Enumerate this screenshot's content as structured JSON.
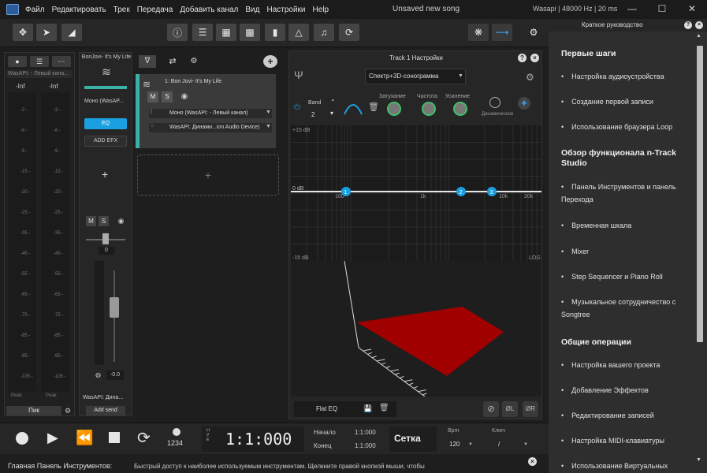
{
  "menu": [
    "Файл",
    "Редактировать",
    "Трек",
    "Передача",
    "Добавить канал",
    "Вид",
    "Настройки",
    "Help"
  ],
  "window_title": "Unsaved new song",
  "audio_info": "Wasapi | 48000 Hz | 20 ms",
  "guide": {
    "title": "Краткое руководство",
    "sections": [
      {
        "heading": "Первые шаги",
        "items": [
          "Настройка аудиоустройства",
          "Создание первой записи",
          "Использование браузера Loop"
        ]
      },
      {
        "heading": "Обзор функционала n-Track Studio",
        "items": [
          "Панель Инструментов и панель Перехода",
          "Временная шкала",
          "Mixer",
          "Step Sequencer и Piano Roll",
          "Музыкальное сотрудничество с Songtree"
        ]
      },
      {
        "heading": "Общие операции",
        "items": [
          "Настройка вашего проекта",
          "Добавление Эффектов",
          "Редактирование записей",
          "Настройка MIDI-клавиатуры",
          "Использование Виртуальных"
        ]
      }
    ]
  },
  "master": {
    "device": "WasAPI: - Левый кана...",
    "left_peak": "-Inf",
    "right_peak": "-Inf",
    "scale": [
      "-3 -",
      "-6 -",
      "-9 -",
      "-15 -",
      "-20 -",
      "-25 -",
      "-35 -",
      "-45 -",
      "-55 -",
      "-65 -",
      "-75 -",
      "-85 -",
      "-95 -",
      "-105 -"
    ],
    "peak_left": "Peak",
    "peak_right": "Peak",
    "peak_button": "Пик"
  },
  "strip": {
    "name": "BonJovi- It's My Life",
    "input": "Моно (WasAP...",
    "eq": "EQ",
    "add_efx": "ADD EFX",
    "m": "M",
    "s": "S",
    "volume": "0",
    "pan": "-0.0",
    "output": "WasAPI: Дина...",
    "add_send": "Add send"
  },
  "track": {
    "title": "1: Bon Jovi- It's My Life",
    "m": "M",
    "s": "S",
    "input": "Моно (WasAPI: - Левый канал)",
    "output": "WasAPI: Динами...ion  Audio  Device)"
  },
  "settings": {
    "title": "Track 1 Настройки",
    "mode": "Спектр+3D-сонограмма",
    "band_label": "Band",
    "band_value": "2",
    "attenuation": "Затухание",
    "frequency": "Частота",
    "gain": "Усиление",
    "dynamic": "Динамическое",
    "graph": {
      "top": "+15 dB",
      "mid": "0 dB",
      "bottom": "-15 dB",
      "log": "LOG",
      "x_labels": [
        "100",
        "1k",
        "10k",
        "20k"
      ],
      "bands": [
        "1",
        "2",
        "3"
      ]
    },
    "preset": "Flat EQ",
    "ol": "ØL",
    "or": "ØR"
  },
  "transport": {
    "live": "LIVE",
    "counter": "1:1:000",
    "start_label": "Начало",
    "start_value": "1:1:000",
    "end_label": "Конец",
    "end_value": "1:1:000",
    "grid": "Сетка",
    "bpm_label": "Bpm",
    "bpm_value": "120",
    "key_label": "Ключ",
    "key_value": "/",
    "count_in": "1234"
  },
  "status": {
    "label": "Главная Панель Инструментов:",
    "text": "Быстрый доступ к наиболее используемым инструментам. Щелкните правой кнопкой мыши, чтобы"
  },
  "colors": {
    "accent": "#1a9fe0",
    "teal": "#3ab0a8",
    "sono_red": "#a00000"
  }
}
